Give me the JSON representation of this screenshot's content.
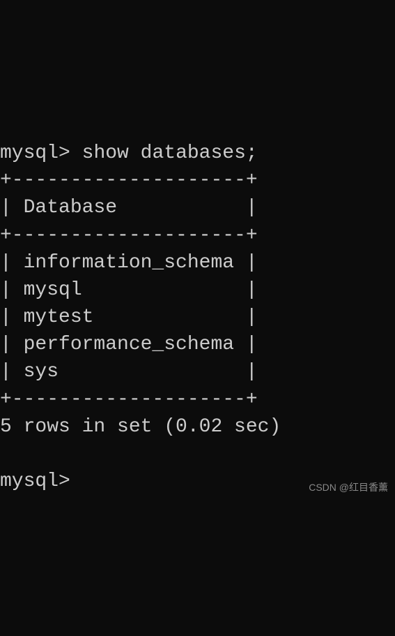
{
  "terminal": {
    "prompt": "mysql>",
    "command": "show databases;",
    "table_border": "+--------------------+",
    "column_header_line": "| Database           |",
    "rows": [
      "| information_schema |",
      "| mysql              |",
      "| mytest             |",
      "| performance_schema |",
      "| sys                |"
    ],
    "result_summary": "5 rows in set (0.02 sec)",
    "blank": ""
  },
  "watermark": "CSDN @红目香薰"
}
